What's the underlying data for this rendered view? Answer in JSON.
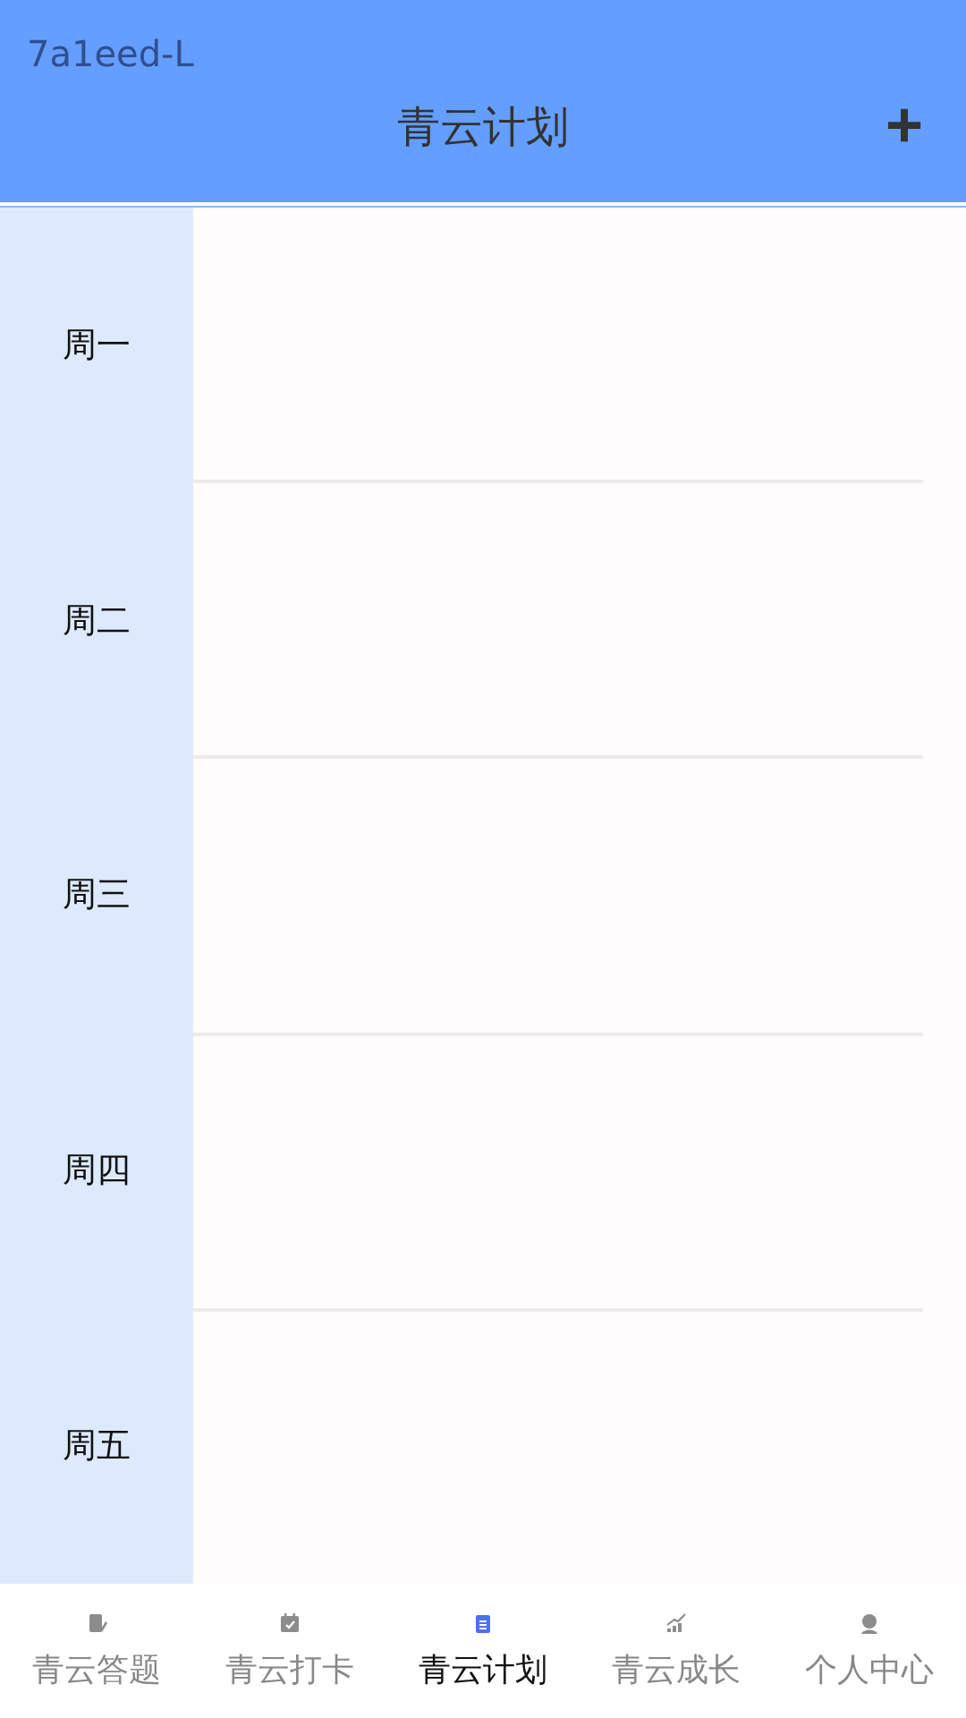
{
  "debug_label": "7a1eed-L",
  "header": {
    "title": "青云计划",
    "add_button": "+"
  },
  "days": [
    {
      "label": "周一"
    },
    {
      "label": "周二"
    },
    {
      "label": "周三"
    },
    {
      "label": "周四"
    },
    {
      "label": "周五"
    }
  ],
  "tabs": [
    {
      "label": "青云答题",
      "kind": "note",
      "selected": false
    },
    {
      "label": "青云打卡",
      "kind": "calendar",
      "selected": false
    },
    {
      "label": "青云计划",
      "kind": "clipboard",
      "selected": true
    },
    {
      "label": "青云成长",
      "kind": "chart",
      "selected": false
    },
    {
      "label": "个人中心",
      "kind": "person",
      "selected": false
    }
  ]
}
